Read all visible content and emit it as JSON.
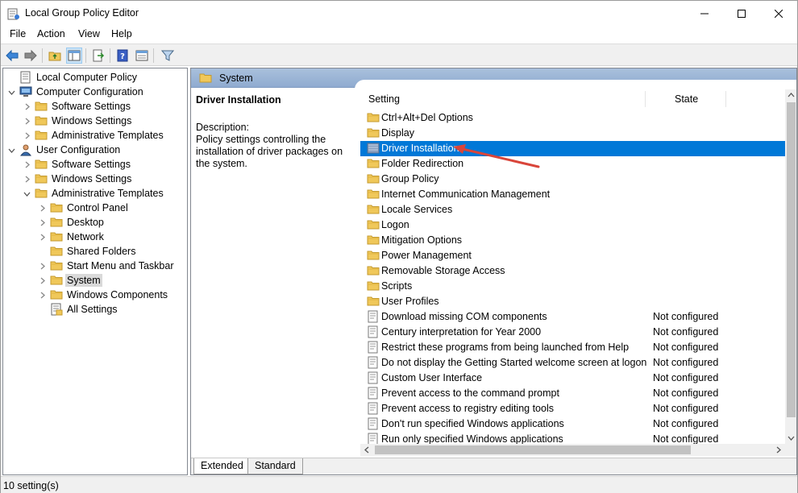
{
  "window": {
    "title": "Local Group Policy Editor"
  },
  "menu": [
    "File",
    "Action",
    "View",
    "Help"
  ],
  "tree": [
    {
      "label": "Local Computer Policy",
      "icon": "policy-doc-icon",
      "level": 0,
      "chevron": ""
    },
    {
      "label": "Computer Configuration",
      "icon": "computer-icon",
      "level": 0,
      "chevron": "down"
    },
    {
      "label": "Software Settings",
      "icon": "folder-icon",
      "level": 1,
      "chevron": "right"
    },
    {
      "label": "Windows Settings",
      "icon": "folder-icon",
      "level": 1,
      "chevron": "right"
    },
    {
      "label": "Administrative Templates",
      "icon": "folder-icon",
      "level": 1,
      "chevron": "right"
    },
    {
      "label": "User Configuration",
      "icon": "user-icon",
      "level": 0,
      "chevron": "down"
    },
    {
      "label": "Software Settings",
      "icon": "folder-icon",
      "level": 1,
      "chevron": "right"
    },
    {
      "label": "Windows Settings",
      "icon": "folder-icon",
      "level": 1,
      "chevron": "right"
    },
    {
      "label": "Administrative Templates",
      "icon": "folder-icon",
      "level": 1,
      "chevron": "down"
    },
    {
      "label": "Control Panel",
      "icon": "folder-icon",
      "level": 2,
      "chevron": "right"
    },
    {
      "label": "Desktop",
      "icon": "folder-icon",
      "level": 2,
      "chevron": "right"
    },
    {
      "label": "Network",
      "icon": "folder-icon",
      "level": 2,
      "chevron": "right"
    },
    {
      "label": "Shared Folders",
      "icon": "folder-icon",
      "level": 2,
      "chevron": ""
    },
    {
      "label": "Start Menu and Taskbar",
      "icon": "folder-icon",
      "level": 2,
      "chevron": "right"
    },
    {
      "label": "System",
      "icon": "folder-icon",
      "level": 2,
      "chevron": "right",
      "selected": true
    },
    {
      "label": "Windows Components",
      "icon": "folder-icon",
      "level": 2,
      "chevron": "right"
    },
    {
      "label": "All Settings",
      "icon": "all-settings-icon",
      "level": 2,
      "chevron": ""
    }
  ],
  "header": {
    "title": "System"
  },
  "description": {
    "title": "Driver Installation",
    "label": "Description:",
    "text": "Policy settings controlling the installation of driver packages on the system."
  },
  "columns": {
    "setting": "Setting",
    "state": "State"
  },
  "rows": [
    {
      "name": "Ctrl+Alt+Del Options",
      "type": "folder",
      "state": ""
    },
    {
      "name": "Display",
      "type": "folder",
      "state": ""
    },
    {
      "name": "Driver Installation",
      "type": "folder-open",
      "state": "",
      "selected": true
    },
    {
      "name": "Folder Redirection",
      "type": "folder",
      "state": ""
    },
    {
      "name": "Group Policy",
      "type": "folder",
      "state": ""
    },
    {
      "name": "Internet Communication Management",
      "type": "folder",
      "state": ""
    },
    {
      "name": "Locale Services",
      "type": "folder",
      "state": ""
    },
    {
      "name": "Logon",
      "type": "folder",
      "state": ""
    },
    {
      "name": "Mitigation Options",
      "type": "folder",
      "state": ""
    },
    {
      "name": "Power Management",
      "type": "folder",
      "state": ""
    },
    {
      "name": "Removable Storage Access",
      "type": "folder",
      "state": ""
    },
    {
      "name": "Scripts",
      "type": "folder",
      "state": ""
    },
    {
      "name": "User Profiles",
      "type": "folder",
      "state": ""
    },
    {
      "name": "Download missing COM components",
      "type": "setting",
      "state": "Not configured"
    },
    {
      "name": "Century interpretation for Year 2000",
      "type": "setting",
      "state": "Not configured"
    },
    {
      "name": "Restrict these programs from being launched from Help",
      "type": "setting",
      "state": "Not configured"
    },
    {
      "name": "Do not display the Getting Started welcome screen at logon",
      "type": "setting",
      "state": "Not configured"
    },
    {
      "name": "Custom User Interface",
      "type": "setting",
      "state": "Not configured"
    },
    {
      "name": "Prevent access to the command prompt",
      "type": "setting",
      "state": "Not configured"
    },
    {
      "name": "Prevent access to registry editing tools",
      "type": "setting",
      "state": "Not configured"
    },
    {
      "name": "Don't run specified Windows applications",
      "type": "setting",
      "state": "Not configured"
    },
    {
      "name": "Run only specified Windows applications",
      "type": "setting",
      "state": "Not configured"
    }
  ],
  "tabs": [
    "Extended",
    "Standard"
  ],
  "status": {
    "text": "10 setting(s)"
  },
  "colors": {
    "selection": "#0078d7",
    "header": "#a9c0dc",
    "folder": "#f0c85a",
    "annotation_arrow": "#d9453a"
  }
}
